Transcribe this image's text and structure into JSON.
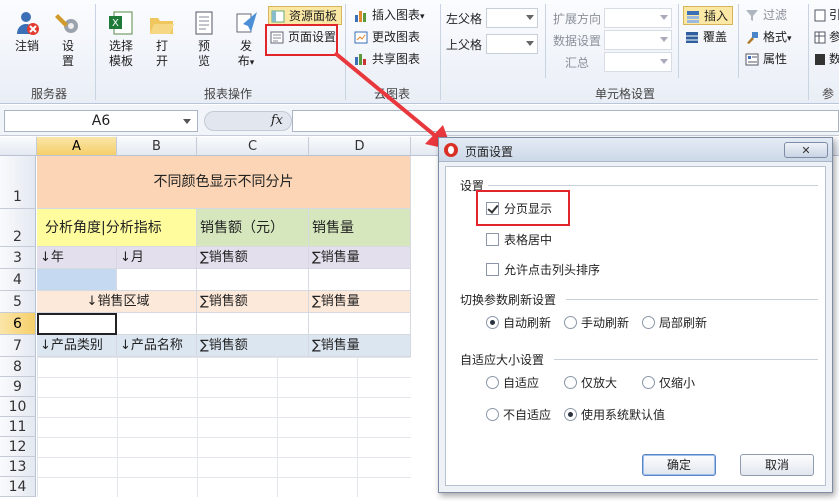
{
  "ribbon": {
    "buttons": {
      "logout": "注销",
      "settings": "设\n置",
      "select_template": "选择\n模板",
      "open": "打\n开",
      "preview": "预\n览",
      "publish": "发\n布"
    },
    "publish_arrow": "▾",
    "small_buttons": {
      "resource_panel": "资源面板",
      "page_setup": "页面设置",
      "insert_chart": "插入图表",
      "change_chart": "更改图表",
      "share_chart": "共享图表",
      "insert": "插入",
      "cover": "覆盖",
      "filter": "过滤",
      "format": "格式",
      "attribute": "属性"
    },
    "labels": {
      "left_parent": "左父格",
      "top_parent": "上父格",
      "expand_direction": "扩展方向",
      "data_setting": "数据设置",
      "summary": "汇总"
    },
    "groups": {
      "server": "服务器",
      "report_ops": "报表操作",
      "cloud_chart": "云图表",
      "cell_setting": "单元格设置",
      "param": "参"
    },
    "cut_items": [
      "引",
      "参",
      "数"
    ]
  },
  "formula_bar": {
    "cell_ref": "A6",
    "fx": "fx",
    "value": ""
  },
  "grid": {
    "columns": [
      "A",
      "B",
      "C",
      "D"
    ],
    "rows": [
      "1",
      "2",
      "3",
      "4",
      "5",
      "6",
      "7",
      "8",
      "9",
      "10",
      "11",
      "12",
      "13",
      "14"
    ],
    "cells": {
      "title": "不同颜色显示不同分片",
      "angle_indicator": "分析角度|分析指标",
      "sales_amount_yuan": "销售额（元）",
      "sales_qty": "销售量",
      "r3_a": "↓年",
      "r3_b": "↓月",
      "r3_c": "∑销售额",
      "r3_d": "∑销售量",
      "r5_ab": "↓销售区域",
      "r5_c": "∑销售额",
      "r5_d": "∑销售量",
      "r7_a": "↓产品类别",
      "r7_b": "↓产品名称",
      "r7_c": "∑销售额",
      "r7_d": "∑销售量"
    }
  },
  "dialog": {
    "title": "页面设置",
    "section_settings": "设置",
    "paginate": "分页显示",
    "center_table": "表格居中",
    "allow_sort": "允许点击列头排序",
    "section_refresh": "切换参数刷新设置",
    "refresh_options": [
      "自动刷新",
      "手动刷新",
      "局部刷新"
    ],
    "section_fit": "自适应大小设置",
    "fit_options": [
      "自适应",
      "仅放大",
      "仅缩小",
      "不自适应",
      "使用系统默认值"
    ],
    "ok": "确定",
    "cancel": "取消"
  },
  "colors": {
    "title_fill": "#fbd5b5",
    "header_yellow": "#fffc9e",
    "header_green": "#d6e7bd",
    "row3_fill": "#e4dfec",
    "row4_blue": "#c5d9f1",
    "row5_fill": "#fde9d9",
    "row7_fill": "#dce6f1",
    "highlight_red": "#e0262b",
    "arrow_red": "#e8383d"
  }
}
